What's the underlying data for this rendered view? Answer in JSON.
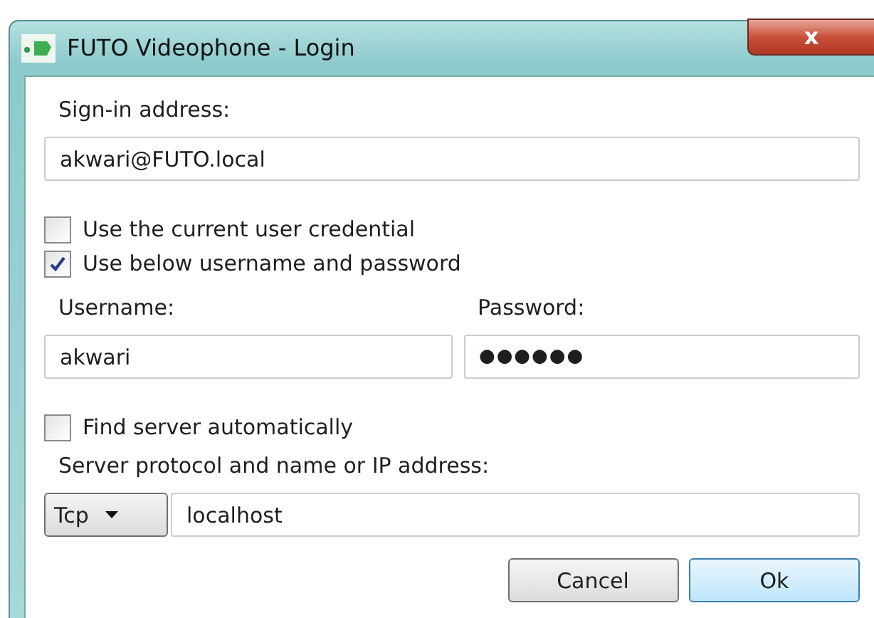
{
  "window": {
    "title": "FUTO Videophone - Login",
    "close": "x"
  },
  "sign_in": {
    "label": "Sign-in address:",
    "value": "akwari@FUTO.local"
  },
  "options": [
    {
      "label": "Use the current user credential",
      "checked": false
    },
    {
      "label": "Use below username and password",
      "checked": true
    }
  ],
  "username": {
    "label": "Username:",
    "value": "akwari"
  },
  "password": {
    "label": "Password:",
    "value": "●●●●●●"
  },
  "find_server": {
    "label": "Find server automatically",
    "checked": false
  },
  "server": {
    "label": "Server protocol and name or IP address:",
    "protocol": "Tcp",
    "value": "localhost"
  },
  "buttons": [
    {
      "label": "Cancel",
      "kind": "normal"
    },
    {
      "label": "Ok",
      "kind": "default"
    }
  ]
}
